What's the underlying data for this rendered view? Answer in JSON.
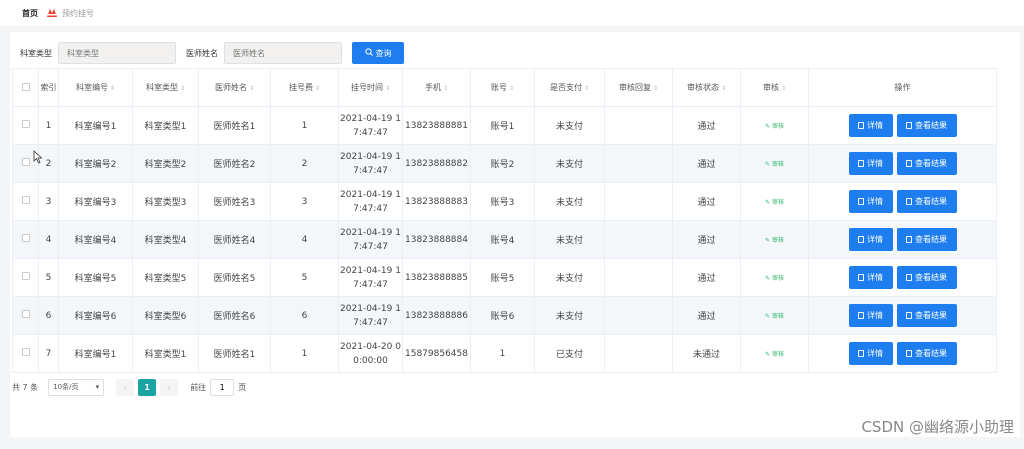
{
  "breadcrumb": {
    "home": "首页",
    "current": "预约挂号"
  },
  "search": {
    "dept_type_label": "科室类型",
    "dept_type_placeholder": "科室类型",
    "doctor_label": "医师姓名",
    "doctor_placeholder": "医师姓名",
    "query_button": "查询"
  },
  "table": {
    "headers": {
      "index": "索引",
      "dept_no": "科室编号",
      "dept_type": "科室类型",
      "doctor": "医师姓名",
      "fee": "挂号费",
      "time": "挂号时间",
      "phone": "手机",
      "account": "账号",
      "paid": "是否支付",
      "reply": "审核回复",
      "status": "审核状态",
      "audit": "审核",
      "ops": "操作"
    },
    "rows": [
      {
        "index": "1",
        "dept_no": "科室编号1",
        "dept_type": "科室类型1",
        "doctor": "医师姓名1",
        "fee": "1",
        "time1": "2021-04-19 1",
        "time2": "7:47:47",
        "phone": "13823888881",
        "account": "账号1",
        "paid": "未支付",
        "reply": "",
        "status": "通过",
        "audit": "审核",
        "detail": "详情",
        "result": "查看结果"
      },
      {
        "index": "2",
        "dept_no": "科室编号2",
        "dept_type": "科室类型2",
        "doctor": "医师姓名2",
        "fee": "2",
        "time1": "2021-04-19 1",
        "time2": "7:47:47",
        "phone": "13823888882",
        "account": "账号2",
        "paid": "未支付",
        "reply": "",
        "status": "通过",
        "audit": "审核",
        "detail": "详情",
        "result": "查看结果"
      },
      {
        "index": "3",
        "dept_no": "科室编号3",
        "dept_type": "科室类型3",
        "doctor": "医师姓名3",
        "fee": "3",
        "time1": "2021-04-19 1",
        "time2": "7:47:47",
        "phone": "13823888883",
        "account": "账号3",
        "paid": "未支付",
        "reply": "",
        "status": "通过",
        "audit": "审核",
        "detail": "详情",
        "result": "查看结果"
      },
      {
        "index": "4",
        "dept_no": "科室编号4",
        "dept_type": "科室类型4",
        "doctor": "医师姓名4",
        "fee": "4",
        "time1": "2021-04-19 1",
        "time2": "7:47:47",
        "phone": "13823888884",
        "account": "账号4",
        "paid": "未支付",
        "reply": "",
        "status": "通过",
        "audit": "审核",
        "detail": "详情",
        "result": "查看结果"
      },
      {
        "index": "5",
        "dept_no": "科室编号5",
        "dept_type": "科室类型5",
        "doctor": "医师姓名5",
        "fee": "5",
        "time1": "2021-04-19 1",
        "time2": "7:47:47",
        "phone": "13823888885",
        "account": "账号5",
        "paid": "未支付",
        "reply": "",
        "status": "通过",
        "audit": "审核",
        "detail": "详情",
        "result": "查看结果"
      },
      {
        "index": "6",
        "dept_no": "科室编号6",
        "dept_type": "科室类型6",
        "doctor": "医师姓名6",
        "fee": "6",
        "time1": "2021-04-19 1",
        "time2": "7:47:47",
        "phone": "13823888886",
        "account": "账号6",
        "paid": "未支付",
        "reply": "",
        "status": "通过",
        "audit": "审核",
        "detail": "详情",
        "result": "查看结果"
      },
      {
        "index": "7",
        "dept_no": "科室编号1",
        "dept_type": "科室类型1",
        "doctor": "医师姓名1",
        "fee": "1",
        "time1": "2021-04-20 0",
        "time2": "0:00:00",
        "phone": "15879856458",
        "account": "1",
        "paid": "已支付",
        "reply": "",
        "status": "未通过",
        "audit": "审核",
        "detail": "详情",
        "result": "查看结果"
      }
    ]
  },
  "pager": {
    "total": "共 7 条",
    "page_size": "10条/页",
    "current_page": "1",
    "goto_label": "前往",
    "goto_value": "1",
    "goto_unit": "页"
  },
  "watermark": "CSDN @幽络源小助理",
  "colors": {
    "primary": "#1e7ef0",
    "page_active": "#19a3a3",
    "audit_link": "#2cb56c",
    "logo": "#e8412c"
  }
}
